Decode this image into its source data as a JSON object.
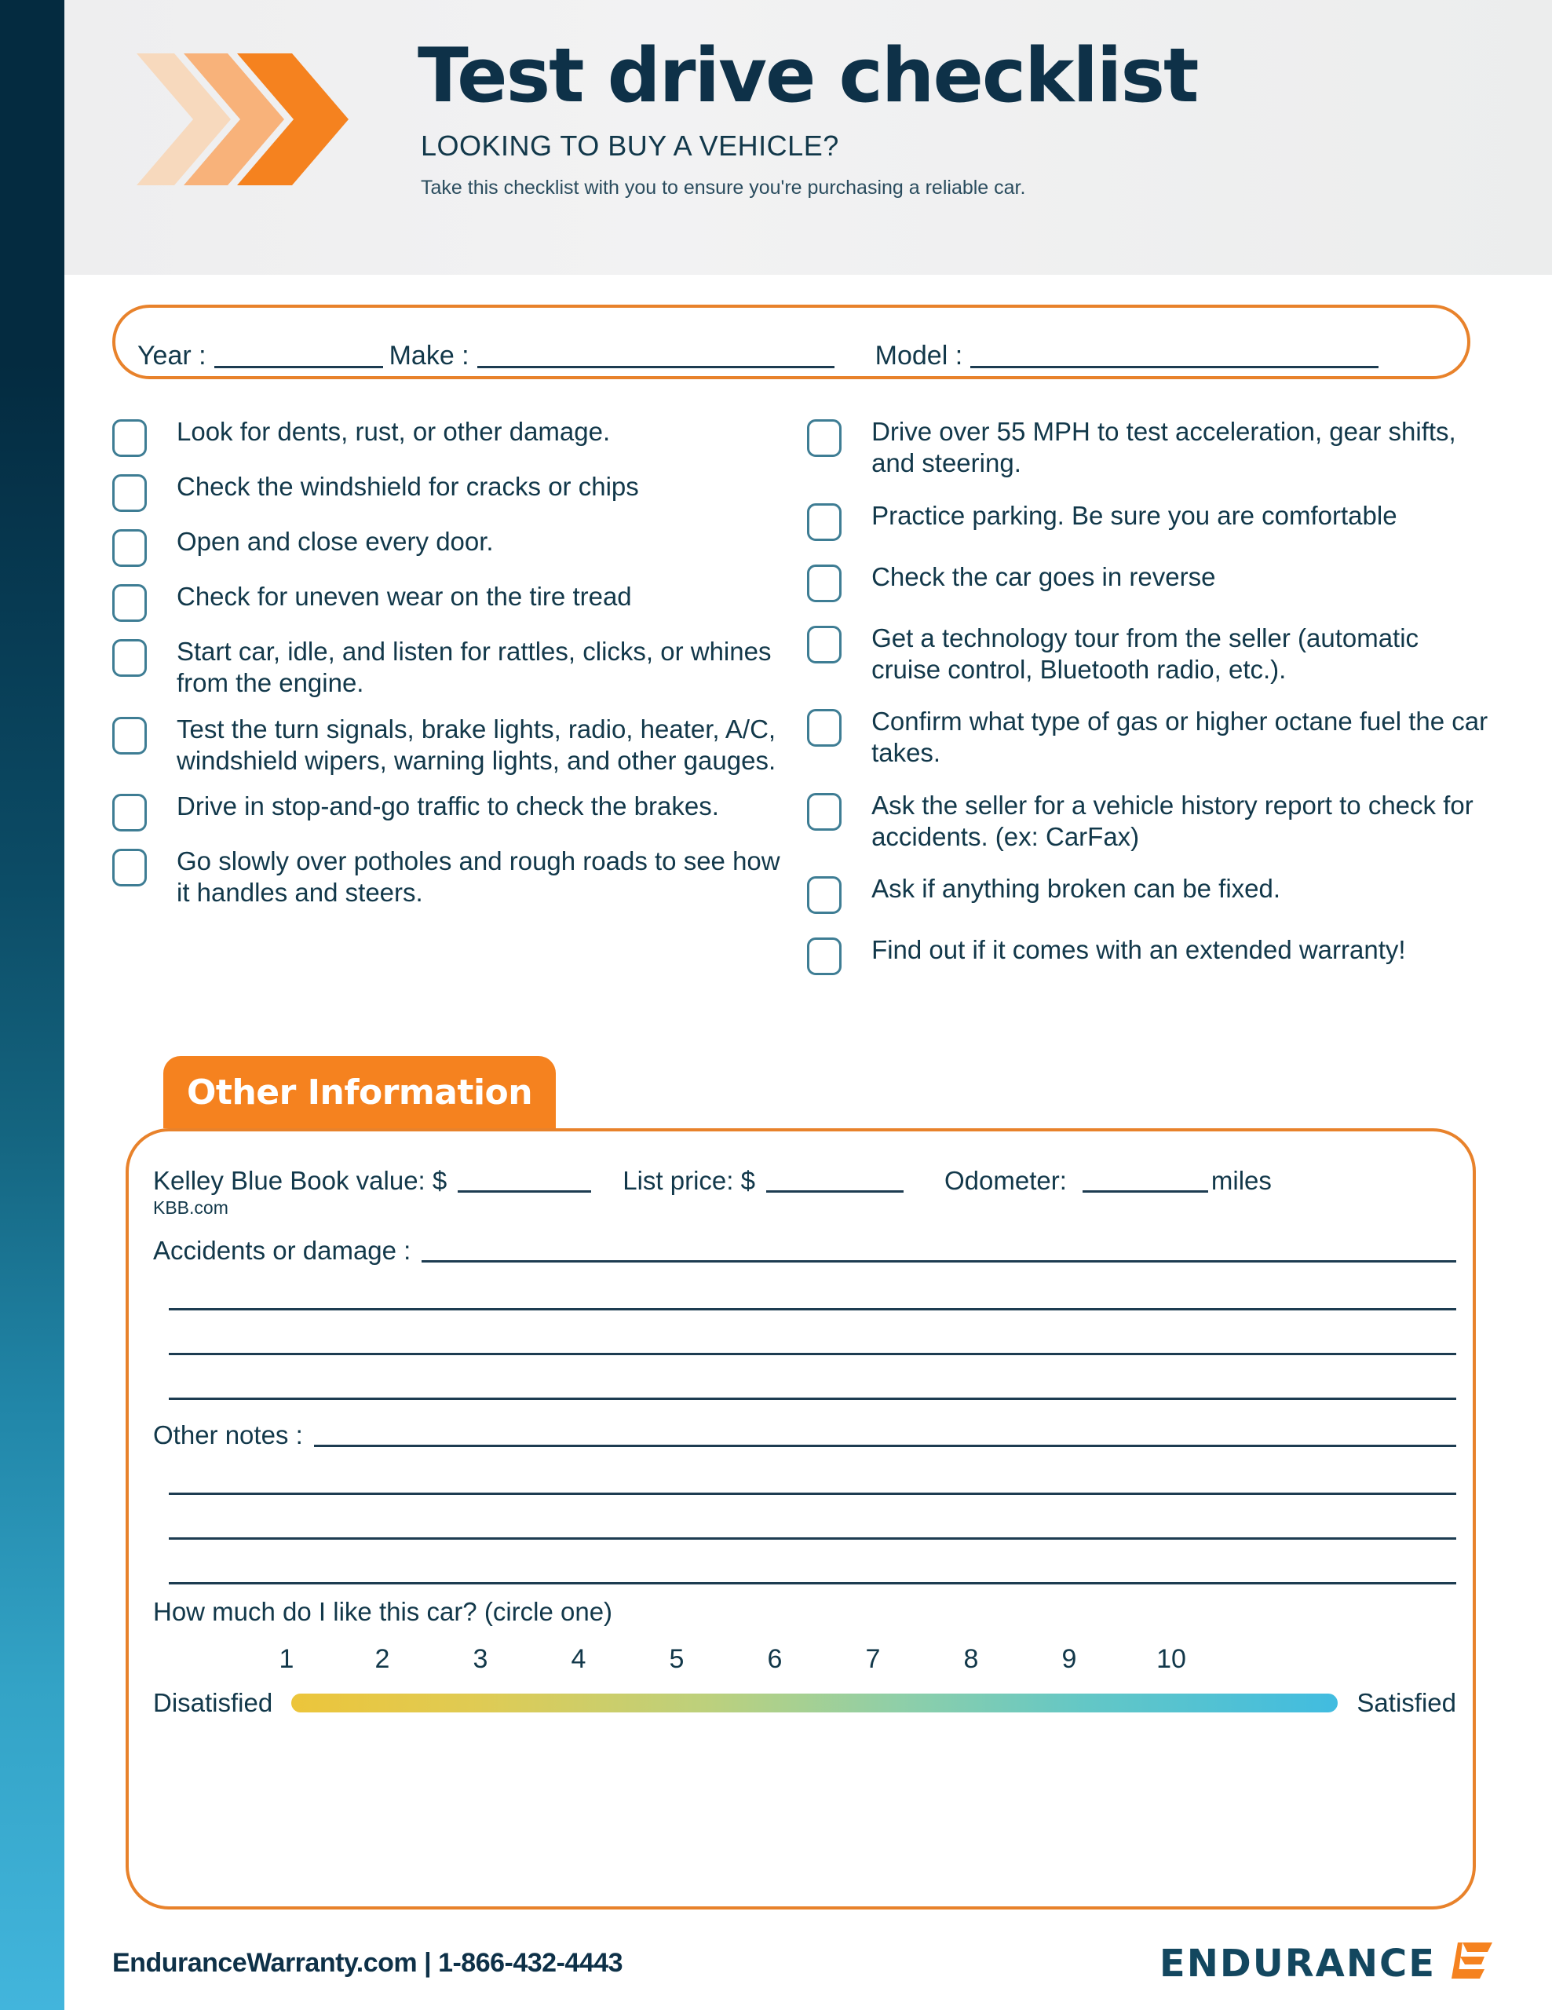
{
  "brand": {
    "accent_orange": "#f5821f",
    "border_orange": "#e8822b",
    "navy": "#0e3148",
    "teal": "#3e7d94",
    "edge_top": "#042b40",
    "edge_bottom": "#42b5dc"
  },
  "header": {
    "title": "Test drive checklist",
    "subtitle": "LOOKING TO BUY A VEHICLE?",
    "description": "Take this checklist with you to ensure you're purchasing a reliable car."
  },
  "vehicle": {
    "year_label": "Year :",
    "make_label": "Make :",
    "model_label": "Model :",
    "year_value": "",
    "make_value": "",
    "model_value": ""
  },
  "checklist": {
    "left": [
      "Look for dents, rust, or other damage.",
      "Check the windshield for cracks or chips",
      "Open and close every door.",
      "Check for uneven wear on the tire tread",
      "Start car, idle, and listen for rattles, clicks, or whines from the engine.",
      "Test the turn signals, brake lights, radio, heater, A/C, windshield wipers, warning lights, and other gauges.",
      "Drive in stop-and-go traffic to check the brakes.",
      "Go slowly over potholes and rough roads to see how it handles and steers."
    ],
    "right": [
      "Drive over 55 MPH to test acceleration, gear shifts, and steering.",
      "Practice parking. Be sure you are comfortable",
      "Check the car goes in reverse",
      "Get a technology tour from the seller (automatic cruise control, Bluetooth radio, etc.).",
      "Confirm what type of gas or higher octane fuel the car takes.",
      "Ask the seller for a vehicle history report to check for accidents. (ex: CarFax)",
      "Ask if anything broken can be fixed.",
      "Find out if it comes with an extended warranty!"
    ]
  },
  "other_information": {
    "tab_label": "Other Information",
    "kbb_label": "Kelley Blue Book value: $",
    "kbb_sub": "KBB.com",
    "kbb_value": "",
    "list_price_label": "List price: $",
    "list_price_value": "",
    "odometer_label": "Odometer:",
    "odometer_value": "",
    "odometer_unit": "miles",
    "accidents_label": "Accidents or damage :",
    "accidents_value": "",
    "other_notes_label": "Other notes :",
    "other_notes_value": "",
    "rating_question": "How much do I like this car? (circle one)",
    "scale_numbers": [
      "1",
      "2",
      "3",
      "4",
      "5",
      "6",
      "7",
      "8",
      "9",
      "10"
    ],
    "scale_low_label": "Disatisfied",
    "scale_high_label": "Satisfied",
    "scale_low_color": "#ecc53b",
    "scale_high_color": "#41bce0"
  },
  "footer": {
    "website": "EnduranceWarranty.com",
    "separator": "|",
    "phone": "1-866-432-4443",
    "logo_word": "ENDURANCE"
  }
}
